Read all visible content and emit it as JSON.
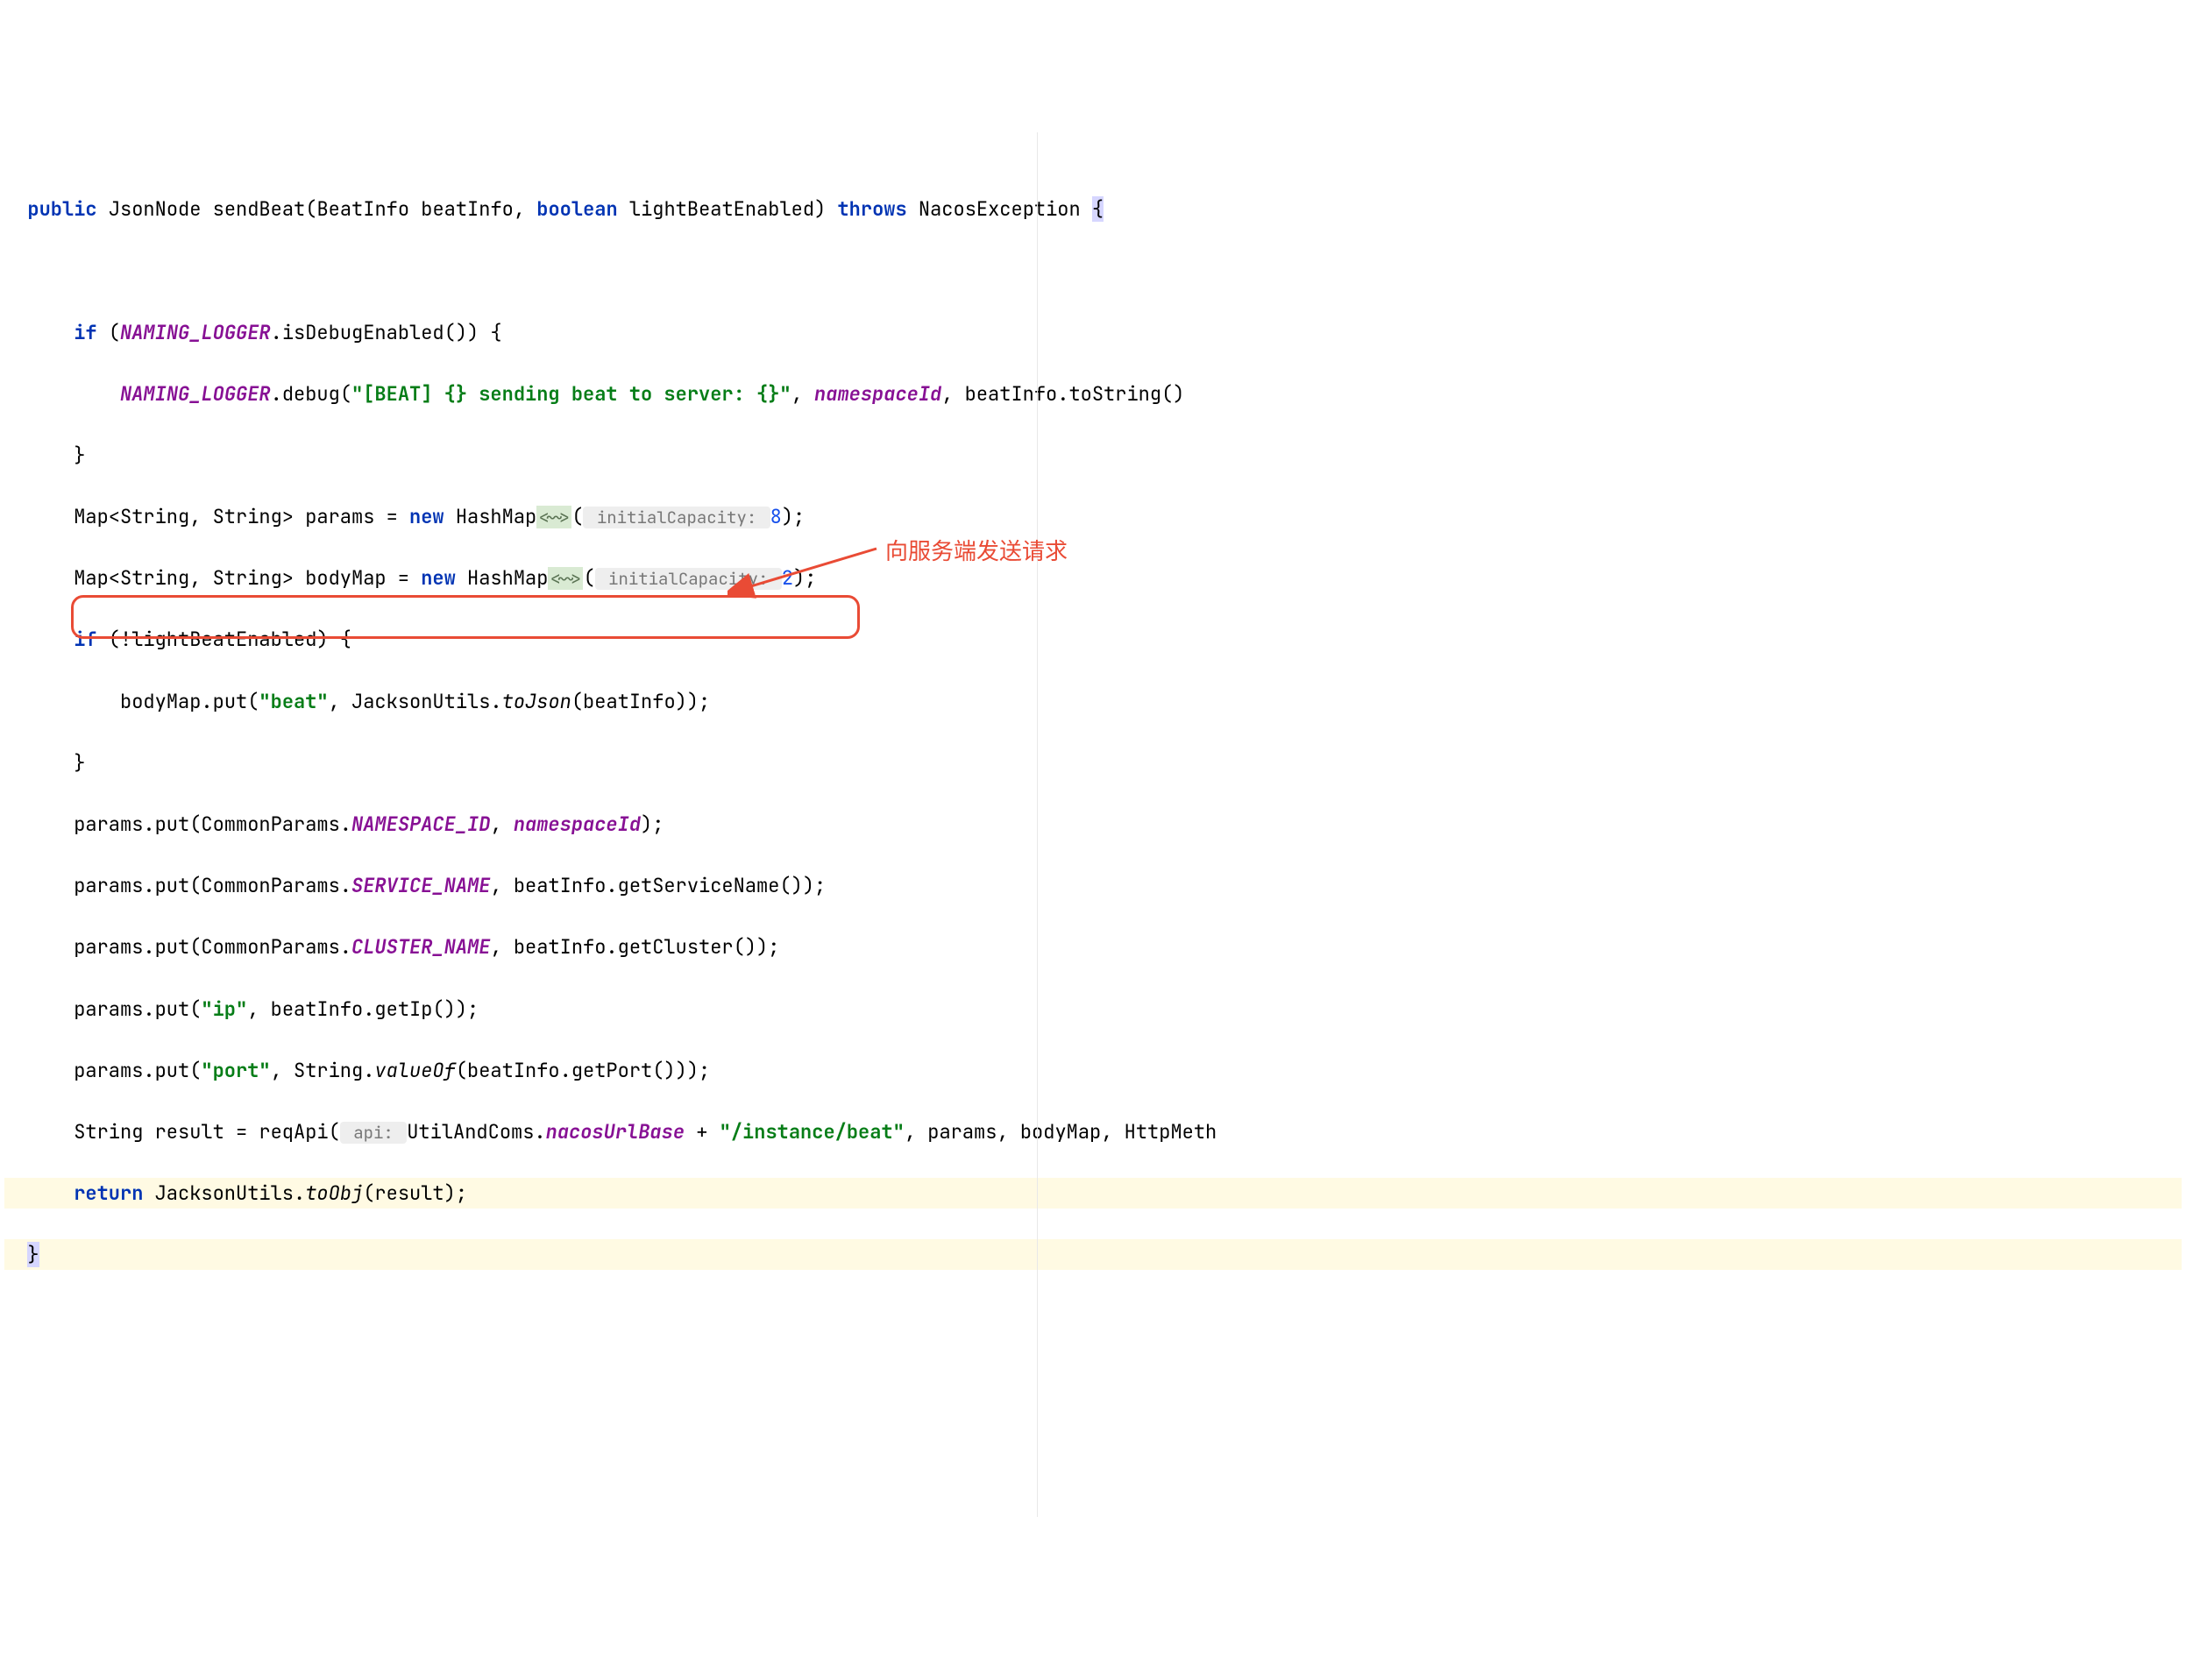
{
  "code": {
    "l1": {
      "kw_public": "public",
      "type_json": "JsonNode",
      "method": "sendBeat",
      "param_type1": "BeatInfo",
      "param_name1": "beatInfo",
      "kw_boolean": "boolean",
      "param_name2": "lightBeatEnabled",
      "kw_throws": "throws",
      "exception": "NacosException",
      "brace": "{"
    },
    "l2": {
      "kw_if": "if",
      "logger": "NAMING_LOGGER",
      "method": ".isDebugEnabled()) {"
    },
    "l3": {
      "logger": "NAMING_LOGGER",
      "method": ".debug(",
      "str": "\"[BEAT] {} sending beat to server: {}\"",
      "comma": ", ",
      "ns": "namespaceId",
      "rest": ", beatInfo.toString()"
    },
    "l4": {
      "brace": "}"
    },
    "l5": {
      "map": "Map<String, String> params = ",
      "kw_new": "new",
      "hashmap": " HashMap",
      "hint_type": "<~>",
      "paren": "(",
      "hint_param": " initialCapacity: ",
      "num": "8",
      "end": ");"
    },
    "l6": {
      "map": "Map<String, String> bodyMap = ",
      "kw_new": "new",
      "hashmap": " HashMap",
      "hint_type": "<~>",
      "paren": "(",
      "hint_param": " initialCapacity: ",
      "num": "2",
      "end": ");"
    },
    "l7": {
      "kw_if": "if",
      "cond": " (!lightBeatEnabled) {"
    },
    "l8": {
      "pre": "bodyMap.put(",
      "str": "\"beat\"",
      "mid": ", JacksonUtils.",
      "static": "toJson",
      "post": "(beatInfo));"
    },
    "l9": {
      "brace": "}"
    },
    "l10": {
      "pre": "params.put(CommonParams.",
      "const": "NAMESPACE_ID",
      "mid": ", ",
      "field": "namespaceId",
      "end": ");"
    },
    "l11": {
      "pre": "params.put(CommonParams.",
      "const": "SERVICE_NAME",
      "mid": ", beatInfo.getServiceName());"
    },
    "l12": {
      "pre": "params.put(CommonParams.",
      "const": "CLUSTER_NAME",
      "mid": ", beatInfo.getCluster());"
    },
    "l13": {
      "pre": "params.put(",
      "str": "\"ip\"",
      "end": ", beatInfo.getIp());"
    },
    "l14": {
      "pre": "params.put(",
      "str": "\"port\"",
      "mid": ", String.",
      "static": "valueOf",
      "end": "(beatInfo.getPort()));"
    },
    "l15": {
      "pre": "String result = reqApi(",
      "hint": " api: ",
      "utils": "UtilAndComs.",
      "field": "nacosUrlBase",
      "plus": " + ",
      "str": "\"/instance/beat\"",
      "mid": ", pa",
      "rams": "rams, bodyMap, HttpMeth"
    },
    "l16": {
      "kw_return": "return",
      "pre": " JacksonUtils.",
      "static": "toObj",
      "end": "(result);"
    },
    "l17": {
      "brace": "}"
    }
  },
  "annotation": {
    "text": "向服务端发送请求"
  }
}
